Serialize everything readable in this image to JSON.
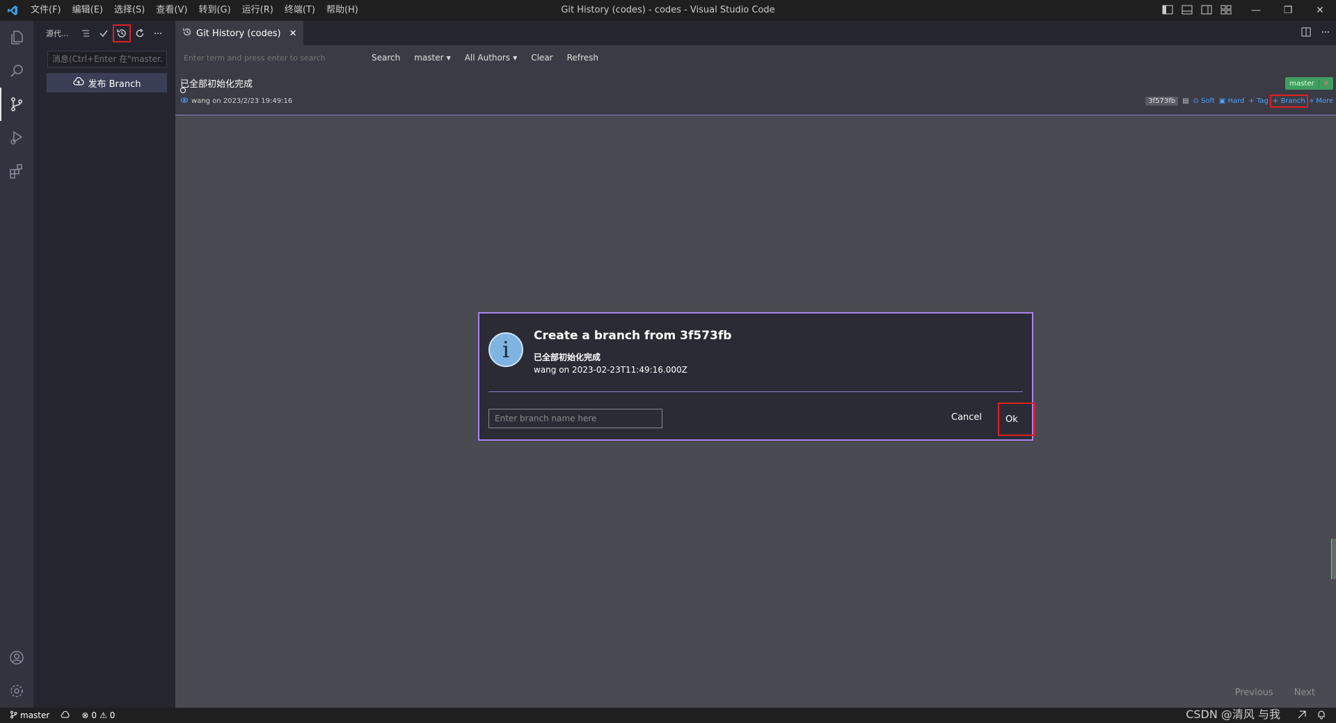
{
  "window": {
    "title": "Git History (codes) - codes - Visual Studio Code",
    "menu": [
      "文件(F)",
      "编辑(E)",
      "选择(S)",
      "查看(V)",
      "转到(G)",
      "运行(R)",
      "终端(T)",
      "帮助(H)"
    ]
  },
  "sidebar": {
    "title": "源代...",
    "message_placeholder": "消息(Ctrl+Enter 在\"master...",
    "publish_label": "发布 Branch"
  },
  "tab": {
    "label": "Git History (codes)"
  },
  "toolbar": {
    "search_placeholder": "Enter term and press enter to search",
    "search_label": "Search",
    "branch_label": "master",
    "authors_label": "All Authors",
    "clear_label": "Clear",
    "refresh_label": "Refresh"
  },
  "commit": {
    "subject": "已全部初始化完成",
    "author_line": "wang on 2023/2/23 19:49:16",
    "branch_tag": "master",
    "branch_tag_close": "✕",
    "hash": "3f573fb",
    "actions": {
      "soft": "Soft",
      "hard": "Hard",
      "tag": "Tag",
      "branch": "Branch",
      "more": "More"
    }
  },
  "pager": {
    "previous": "Previous",
    "next": "Next"
  },
  "dialog": {
    "title": "Create a branch from 3f573fb",
    "subject": "已全部初始化完成",
    "meta": "wang on 2023-02-23T11:49:16.000Z",
    "input_placeholder": "Enter branch name here",
    "cancel_label": "Cancel",
    "ok_label": "Ok"
  },
  "statusbar": {
    "branch": "master",
    "errors": "0",
    "warnings": "0",
    "watermark": "CSDN @清风 与我"
  },
  "colors": {
    "accent_purple": "#a784f0",
    "highlight_red": "#e02020",
    "branch_green": "#3f9e5f",
    "link_blue": "#4da3ff"
  }
}
